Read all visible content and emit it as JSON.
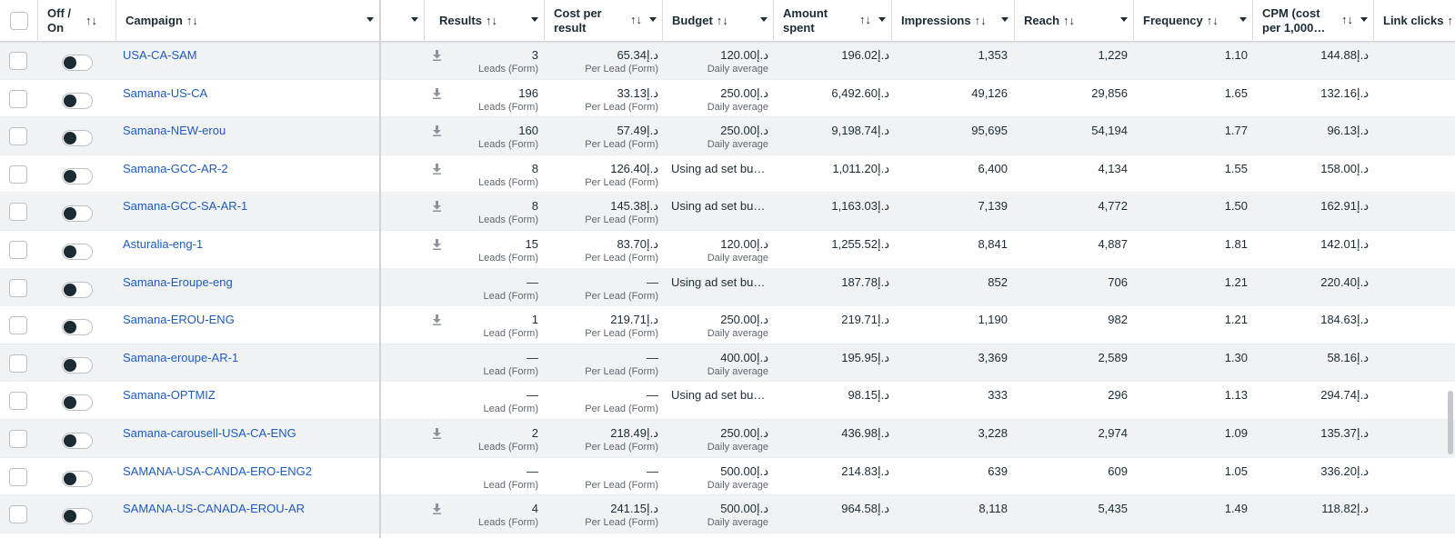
{
  "header": {
    "off_on": "Off / On",
    "campaign": "Campaign",
    "results": "Results",
    "cost_per_result": "Cost per result",
    "budget": "Budget",
    "amount_spent": "Amount spent",
    "impressions": "Impressions",
    "reach": "Reach",
    "frequency": "Frequency",
    "cpm": "CPM (cost per 1,000…",
    "link_clicks": "Link clicks",
    "sort_icon": "↑↓"
  },
  "rows": [
    {
      "campaign": "USA-CA-SAM",
      "results": "3",
      "results_sub": "Leads (Form)",
      "cost": "65.34د.إ",
      "cost_sub": "Per Lead (Form)",
      "budget": "120.00د.إ",
      "budget_sub": "Daily average",
      "spent": "196.02د.إ",
      "impressions": "1,353",
      "reach": "1,229",
      "frequency": "1.10",
      "cpm": "144.88د.إ",
      "download": true
    },
    {
      "campaign": "Samana-US-CA",
      "results": "196",
      "results_sub": "Leads (Form)",
      "cost": "33.13د.إ",
      "cost_sub": "Per Lead (Form)",
      "budget": "250.00د.إ",
      "budget_sub": "Daily average",
      "spent": "6,492.60د.إ",
      "impressions": "49,126",
      "reach": "29,856",
      "frequency": "1.65",
      "cpm": "132.16د.إ",
      "download": true
    },
    {
      "campaign": "Samana-NEW-erou",
      "results": "160",
      "results_sub": "Leads (Form)",
      "cost": "57.49د.إ",
      "cost_sub": "Per Lead (Form)",
      "budget": "250.00د.إ",
      "budget_sub": "Daily average",
      "spent": "9,198.74د.إ",
      "impressions": "95,695",
      "reach": "54,194",
      "frequency": "1.77",
      "cpm": "96.13د.إ",
      "download": true
    },
    {
      "campaign": "Samana-GCC-AR-2",
      "results": "8",
      "results_sub": "Leads (Form)",
      "cost": "126.40د.إ",
      "cost_sub": "Per Lead (Form)",
      "budget": "Using ad set bu…",
      "budget_sub": "",
      "spent": "1,011.20د.إ",
      "impressions": "6,400",
      "reach": "4,134",
      "frequency": "1.55",
      "cpm": "158.00د.إ",
      "download": true
    },
    {
      "campaign": "Samana-GCC-SA-AR-1",
      "results": "8",
      "results_sub": "Leads (Form)",
      "cost": "145.38د.إ",
      "cost_sub": "Per Lead (Form)",
      "budget": "Using ad set bu…",
      "budget_sub": "",
      "spent": "1,163.03د.إ",
      "impressions": "7,139",
      "reach": "4,772",
      "frequency": "1.50",
      "cpm": "162.91د.إ",
      "download": true
    },
    {
      "campaign": "Asturalia-eng-1",
      "results": "15",
      "results_sub": "Leads (Form)",
      "cost": "83.70د.إ",
      "cost_sub": "Per Lead (Form)",
      "budget": "120.00د.إ",
      "budget_sub": "Daily average",
      "spent": "1,255.52د.إ",
      "impressions": "8,841",
      "reach": "4,887",
      "frequency": "1.81",
      "cpm": "142.01د.إ",
      "download": true
    },
    {
      "campaign": "Samana-Eroupe-eng",
      "results": "—",
      "results_sub": "Lead (Form)",
      "cost": "—",
      "cost_sub": "Per Lead (Form)",
      "budget": "Using ad set bu…",
      "budget_sub": "",
      "spent": "187.78د.إ",
      "impressions": "852",
      "reach": "706",
      "frequency": "1.21",
      "cpm": "220.40د.إ",
      "download": false
    },
    {
      "campaign": "Samana-EROU-ENG",
      "results": "1",
      "results_sub": "Lead (Form)",
      "cost": "219.71د.إ",
      "cost_sub": "Per Lead (Form)",
      "budget": "250.00د.إ",
      "budget_sub": "Daily average",
      "spent": "219.71د.إ",
      "impressions": "1,190",
      "reach": "982",
      "frequency": "1.21",
      "cpm": "184.63د.إ",
      "download": true
    },
    {
      "campaign": "Samana-eroupe-AR-1",
      "results": "—",
      "results_sub": "Lead (Form)",
      "cost": "—",
      "cost_sub": "Per Lead (Form)",
      "budget": "400.00د.إ",
      "budget_sub": "Daily average",
      "spent": "195.95د.إ",
      "impressions": "3,369",
      "reach": "2,589",
      "frequency": "1.30",
      "cpm": "58.16د.إ",
      "download": false
    },
    {
      "campaign": "Samana-OPTMIZ",
      "results": "—",
      "results_sub": "Lead (Form)",
      "cost": "—",
      "cost_sub": "Per Lead (Form)",
      "budget": "Using ad set bu…",
      "budget_sub": "",
      "spent": "98.15د.إ",
      "impressions": "333",
      "reach": "296",
      "frequency": "1.13",
      "cpm": "294.74د.إ",
      "download": false
    },
    {
      "campaign": "Samana-carousell-USA-CA-ENG",
      "results": "2",
      "results_sub": "Leads (Form)",
      "cost": "218.49د.إ",
      "cost_sub": "Per Lead (Form)",
      "budget": "250.00د.إ",
      "budget_sub": "Daily average",
      "spent": "436.98د.إ",
      "impressions": "3,228",
      "reach": "2,974",
      "frequency": "1.09",
      "cpm": "135.37د.إ",
      "download": true
    },
    {
      "campaign": "SAMANA-USA-CANDA-ERO-ENG2",
      "results": "—",
      "results_sub": "Lead (Form)",
      "cost": "—",
      "cost_sub": "Per Lead (Form)",
      "budget": "500.00د.إ",
      "budget_sub": "Daily average",
      "spent": "214.83د.إ",
      "impressions": "639",
      "reach": "609",
      "frequency": "1.05",
      "cpm": "336.20د.إ",
      "download": false
    },
    {
      "campaign": "SAMANA-US-CANADA-EROU-AR",
      "results": "4",
      "results_sub": "Leads (Form)",
      "cost": "241.15د.إ",
      "cost_sub": "Per Lead (Form)",
      "budget": "500.00د.إ",
      "budget_sub": "Daily average",
      "spent": "964.58د.إ",
      "impressions": "8,118",
      "reach": "5,435",
      "frequency": "1.49",
      "cpm": "118.82د.إ",
      "download": true
    }
  ],
  "colors": {
    "link": "#1d5bbf",
    "alt_row": "#f1f2f4",
    "toggle_knob": "#1c2b33"
  }
}
